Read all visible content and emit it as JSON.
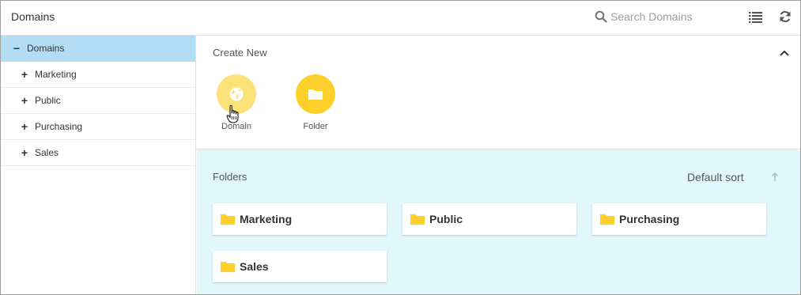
{
  "header": {
    "title": "Domains",
    "search_placeholder": "Search Domains",
    "icons": [
      "search-icon",
      "list-view-icon",
      "refresh-icon"
    ]
  },
  "sidebar": {
    "items": [
      {
        "label": "Domains",
        "toggle": "−",
        "selected": true
      },
      {
        "label": "Marketing",
        "toggle": "+"
      },
      {
        "label": "Public",
        "toggle": "+"
      },
      {
        "label": "Purchasing",
        "toggle": "+"
      },
      {
        "label": "Sales",
        "toggle": "+"
      }
    ]
  },
  "create_new": {
    "title": "Create New",
    "items": [
      {
        "label": "Domain",
        "icon": "globe-icon"
      },
      {
        "label": "Folder",
        "icon": "folder-icon"
      }
    ]
  },
  "folders": {
    "title": "Folders",
    "sort_label": "Default sort",
    "items": [
      {
        "label": "Marketing"
      },
      {
        "label": "Public"
      },
      {
        "label": "Purchasing"
      },
      {
        "label": "Sales"
      }
    ]
  },
  "colors": {
    "accent_yellow": "#fdd02b",
    "selected_row": "#b3dcf5",
    "folders_background": "#e0f7fc"
  }
}
